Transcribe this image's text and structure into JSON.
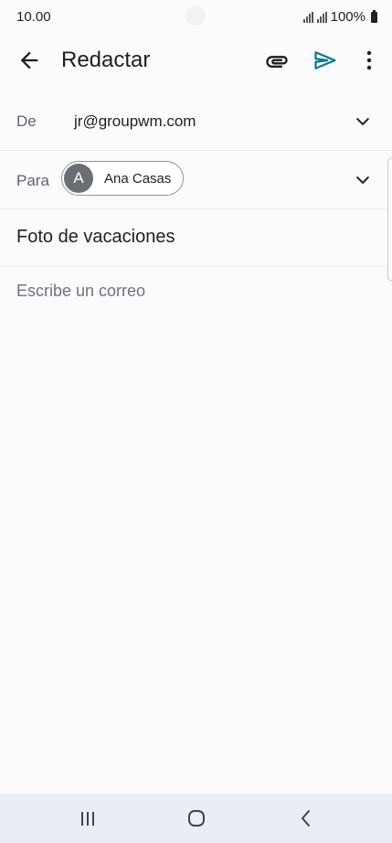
{
  "status_bar": {
    "time": "10.00",
    "battery": "100%"
  },
  "app_bar": {
    "title": "Redactar",
    "icons": [
      "arrow-back-icon",
      "paperclip-icon",
      "send-icon",
      "more-vert-icon"
    ]
  },
  "from": {
    "label": "De",
    "value": "jr@groupwm.com"
  },
  "to": {
    "label": "Para",
    "recipient_initial": "A",
    "recipient_name": "Ana Casas"
  },
  "subject": {
    "value": "Foto de vacaciones"
  },
  "body": {
    "placeholder": "Escribe un correo",
    "value": ""
  },
  "colors": {
    "send_accent": "#0b7a8a",
    "background": "#fbfbfe",
    "nav_bar": "#e8edf6",
    "avatar": "#6b6f75"
  },
  "nav_bar": {
    "icons": [
      "recents-icon",
      "home-icon",
      "back-icon"
    ]
  }
}
